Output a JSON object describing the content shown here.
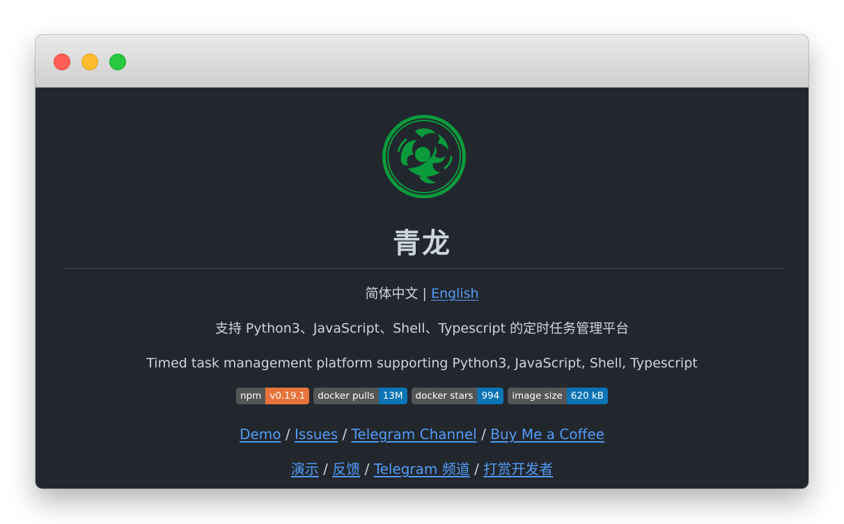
{
  "window": {
    "controls": [
      "close",
      "minimize",
      "maximize"
    ]
  },
  "header": {
    "logo_icon": "qinglong-dragon-logo-icon",
    "title": "青龙"
  },
  "language": {
    "current": "简体中文",
    "separator": "|",
    "english_link": "English"
  },
  "description": {
    "cn": "支持 Python3、JavaScript、Shell、Typescript 的定时任务管理平台",
    "en": "Timed task management platform supporting Python3, JavaScript, Shell, Typescript"
  },
  "badges": [
    {
      "label": "npm",
      "value": "v0.19.1",
      "color": "#e8733a"
    },
    {
      "label": "docker pulls",
      "value": "13M",
      "color": "#0b74b5"
    },
    {
      "label": "docker stars",
      "value": "994",
      "color": "#0b74b5"
    },
    {
      "label": "image size",
      "value": "620 kB",
      "color": "#0b74b5"
    }
  ],
  "links_en": {
    "demo": "Demo",
    "issues": "Issues",
    "telegram": "Telegram Channel",
    "coffee": "Buy Me a Coffee",
    "sep": "/"
  },
  "links_cn": {
    "demo": "演示",
    "issues": "反馈",
    "telegram": "Telegram 频道",
    "donate": "打赏开发者",
    "sep": "/"
  },
  "colors": {
    "background": "#22272e",
    "link": "#539bf5",
    "logo_green": "#0a9b3c"
  }
}
